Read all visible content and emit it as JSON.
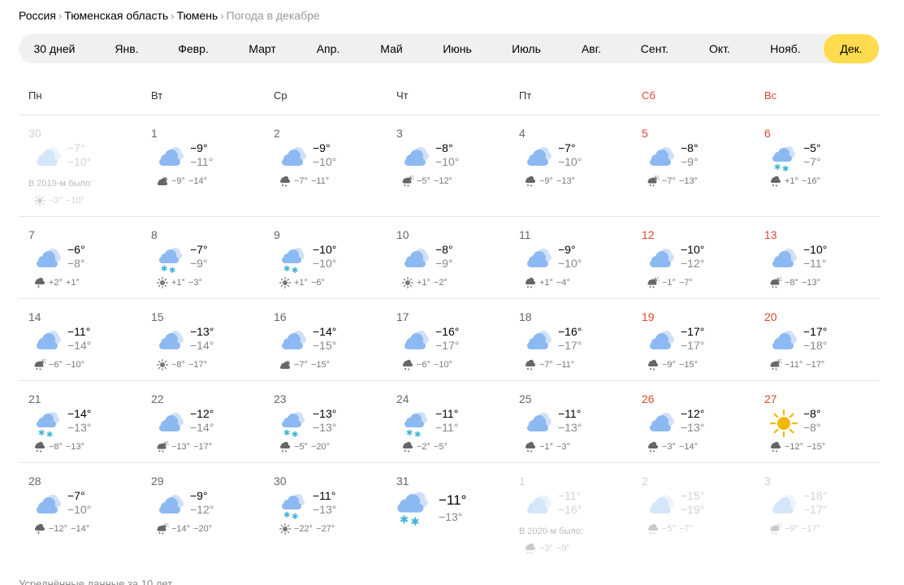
{
  "breadcrumb": [
    {
      "label": "Россия",
      "current": false
    },
    {
      "label": "Тюменская область",
      "current": false
    },
    {
      "label": "Тюмень",
      "current": false
    },
    {
      "label": "Погода в декабре",
      "current": true
    }
  ],
  "months": [
    {
      "label": "30 дней",
      "active": false
    },
    {
      "label": "Янв.",
      "active": false
    },
    {
      "label": "Февр.",
      "active": false
    },
    {
      "label": "Март",
      "active": false
    },
    {
      "label": "Апр.",
      "active": false
    },
    {
      "label": "Май",
      "active": false
    },
    {
      "label": "Июнь",
      "active": false
    },
    {
      "label": "Июль",
      "active": false
    },
    {
      "label": "Авг.",
      "active": false
    },
    {
      "label": "Сент.",
      "active": false
    },
    {
      "label": "Окт.",
      "active": false
    },
    {
      "label": "Нояб.",
      "active": false
    },
    {
      "label": "Дек.",
      "active": true
    }
  ],
  "weekdays": [
    {
      "label": "Пн",
      "weekend": false
    },
    {
      "label": "Вт",
      "weekend": false
    },
    {
      "label": "Ср",
      "weekend": false
    },
    {
      "label": "Чт",
      "weekend": false
    },
    {
      "label": "Пт",
      "weekend": false
    },
    {
      "label": "Сб",
      "weekend": true
    },
    {
      "label": "Вс",
      "weekend": true
    }
  ],
  "weeks": [
    [
      {
        "day": "30",
        "icon": "cloud",
        "max": "−7°",
        "min": "−10°",
        "faded": true,
        "was": "В 2019-м было:",
        "past_icon": "sun",
        "past_max": "−3°",
        "past_min": "−10°"
      },
      {
        "day": "1",
        "icon": "cloud",
        "max": "−9°",
        "min": "−11°",
        "past_icon": "cloud-dark",
        "past_max": "−9°",
        "past_min": "−14°"
      },
      {
        "day": "2",
        "icon": "cloud",
        "max": "−9°",
        "min": "−10°",
        "past_icon": "cloud-snow",
        "past_max": "−7°",
        "past_min": "−11°"
      },
      {
        "day": "3",
        "icon": "cloud",
        "max": "−8°",
        "min": "−10°",
        "past_icon": "sun-cloud-snow",
        "past_max": "−5°",
        "past_min": "−12°"
      },
      {
        "day": "4",
        "icon": "cloud",
        "max": "−7°",
        "min": "−10°",
        "past_icon": "cloud-snow",
        "past_max": "−9°",
        "past_min": "−13°"
      },
      {
        "day": "5",
        "icon": "cloud",
        "max": "−8°",
        "min": "−9°",
        "weekend": true,
        "past_icon": "sun-cloud-snow",
        "past_max": "−7°",
        "past_min": "−13°"
      },
      {
        "day": "6",
        "icon": "snow",
        "max": "−5°",
        "min": "−7°",
        "weekend": true,
        "past_icon": "cloud-snow",
        "past_max": "+1°",
        "past_min": "−16°"
      }
    ],
    [
      {
        "day": "7",
        "icon": "cloud",
        "max": "−6°",
        "min": "−8°",
        "past_icon": "cloud-rain",
        "past_max": "+2°",
        "past_min": "+1°"
      },
      {
        "day": "8",
        "icon": "snow",
        "max": "−7°",
        "min": "−9°",
        "past_icon": "sun",
        "past_max": "+1°",
        "past_min": "−3°"
      },
      {
        "day": "9",
        "icon": "snow",
        "max": "−10°",
        "min": "−10°",
        "past_icon": "sun",
        "past_max": "+1°",
        "past_min": "−6°"
      },
      {
        "day": "10",
        "icon": "cloud",
        "max": "−8°",
        "min": "−9°",
        "past_icon": "sun",
        "past_max": "+1°",
        "past_min": "−2°"
      },
      {
        "day": "11",
        "icon": "cloud",
        "max": "−9°",
        "min": "−10°",
        "past_icon": "cloud-snow",
        "past_max": "+1°",
        "past_min": "−4°"
      },
      {
        "day": "12",
        "icon": "cloud",
        "max": "−10°",
        "min": "−12°",
        "weekend": true,
        "past_icon": "sun-cloud-snow",
        "past_max": "−1°",
        "past_min": "−7°"
      },
      {
        "day": "13",
        "icon": "cloud",
        "max": "−10°",
        "min": "−11°",
        "weekend": true,
        "past_icon": "sun-cloud-snow",
        "past_max": "−8°",
        "past_min": "−13°"
      }
    ],
    [
      {
        "day": "14",
        "icon": "cloud",
        "max": "−11°",
        "min": "−14°",
        "past_icon": "sun-cloud-snow",
        "past_max": "−6°",
        "past_min": "−10°"
      },
      {
        "day": "15",
        "icon": "cloud",
        "max": "−13°",
        "min": "−14°",
        "past_icon": "sun",
        "past_max": "−8°",
        "past_min": "−17°"
      },
      {
        "day": "16",
        "icon": "cloud",
        "max": "−14°",
        "min": "−15°",
        "past_icon": "cloud-dark",
        "past_max": "−7°",
        "past_min": "−15°"
      },
      {
        "day": "17",
        "icon": "cloud",
        "max": "−16°",
        "min": "−17°",
        "past_icon": "cloud-snow",
        "past_max": "−6°",
        "past_min": "−10°"
      },
      {
        "day": "18",
        "icon": "cloud",
        "max": "−16°",
        "min": "−17°",
        "past_icon": "cloud-snow",
        "past_max": "−7°",
        "past_min": "−11°"
      },
      {
        "day": "19",
        "icon": "cloud",
        "max": "−17°",
        "min": "−17°",
        "weekend": true,
        "past_icon": "cloud-snow",
        "past_max": "−9°",
        "past_min": "−15°"
      },
      {
        "day": "20",
        "icon": "cloud",
        "max": "−17°",
        "min": "−18°",
        "weekend": true,
        "past_icon": "sun-cloud-snow",
        "past_max": "−11°",
        "past_min": "−17°"
      }
    ],
    [
      {
        "day": "21",
        "icon": "snow",
        "max": "−14°",
        "min": "−13°",
        "past_icon": "cloud-snow",
        "past_max": "−8°",
        "past_min": "−13°"
      },
      {
        "day": "22",
        "icon": "cloud",
        "max": "−12°",
        "min": "−14°",
        "past_icon": "sun-cloud-snow",
        "past_max": "−13°",
        "past_min": "−17°"
      },
      {
        "day": "23",
        "icon": "snow",
        "max": "−13°",
        "min": "−13°",
        "past_icon": "cloud-snow",
        "past_max": "−5°",
        "past_min": "−20°"
      },
      {
        "day": "24",
        "icon": "snow",
        "max": "−11°",
        "min": "−11°",
        "past_icon": "cloud-snow",
        "past_max": "−2°",
        "past_min": "−5°"
      },
      {
        "day": "25",
        "icon": "cloud",
        "max": "−11°",
        "min": "−13°",
        "past_icon": "cloud-snow",
        "past_max": "−1°",
        "past_min": "−3°"
      },
      {
        "day": "26",
        "icon": "cloud",
        "max": "−12°",
        "min": "−13°",
        "weekend": true,
        "past_icon": "cloud-snow",
        "past_max": "−3°",
        "past_min": "−14°"
      },
      {
        "day": "27",
        "icon": "sun",
        "max": "−8°",
        "min": "−8°",
        "weekend": true,
        "past_icon": "cloud-snow",
        "past_max": "−12°",
        "past_min": "−15°"
      }
    ],
    [
      {
        "day": "28",
        "icon": "cloud",
        "max": "−7°",
        "min": "−10°",
        "past_icon": "cloud-rain",
        "past_max": "−12°",
        "past_min": "−14°"
      },
      {
        "day": "29",
        "icon": "cloud",
        "max": "−9°",
        "min": "−12°",
        "past_icon": "sun-cloud-snow",
        "past_max": "−14°",
        "past_min": "−20°"
      },
      {
        "day": "30",
        "icon": "snow",
        "max": "−11°",
        "min": "−13°",
        "past_icon": "sun",
        "past_max": "−22°",
        "past_min": "−27°"
      },
      {
        "day": "31",
        "icon": "snow",
        "max": "−11°",
        "min": "−13°",
        "today": true
      },
      {
        "day": "1",
        "icon": "cloud",
        "max": "−11°",
        "min": "−16°",
        "faded": true,
        "was": "В 2020-м было:",
        "past_icon": "cloud-snow",
        "past_max": "−3°",
        "past_min": "−9°"
      },
      {
        "day": "2",
        "icon": "cloud",
        "max": "−15°",
        "min": "−19°",
        "faded": true,
        "weekend": true,
        "past_icon": "cloud-snow",
        "past_max": "−5°",
        "past_min": "−7°"
      },
      {
        "day": "3",
        "icon": "cloud",
        "max": "−18°",
        "min": "−17°",
        "faded": true,
        "weekend": true,
        "past_icon": "sun-cloud-snow",
        "past_max": "−9°",
        "past_min": "−17°"
      }
    ]
  ],
  "footnote": "Усреднённые данные за 10 лет",
  "colors": {
    "active_month": "#ffdb4d",
    "weekend": "#d9472b",
    "cloud": "#8db9f2",
    "snow": "#3fb5d9",
    "sun": "#f5b800"
  }
}
